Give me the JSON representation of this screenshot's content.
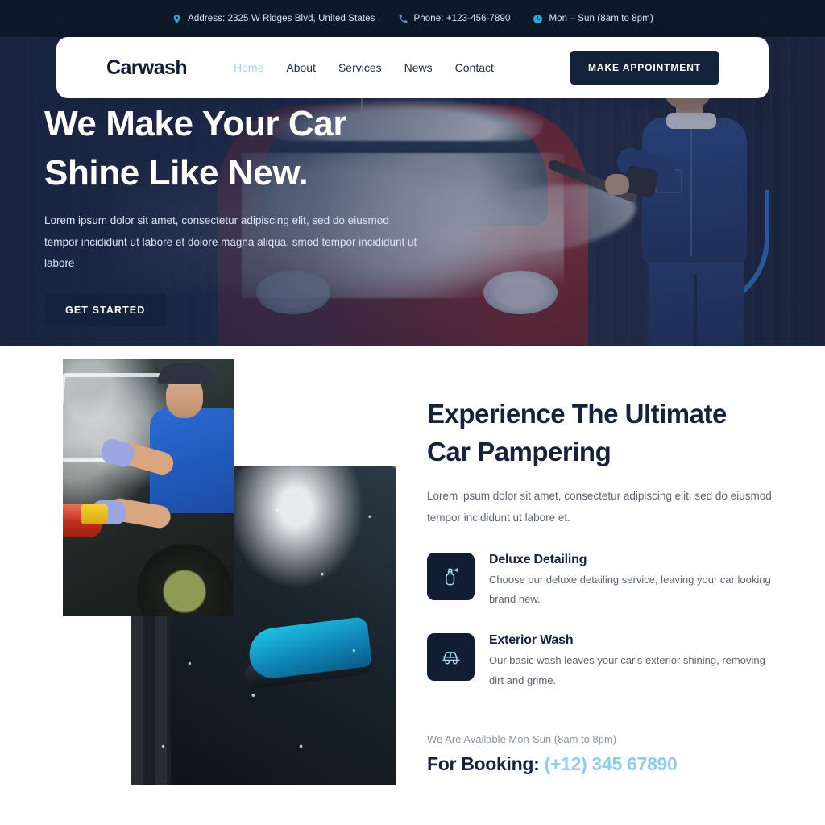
{
  "topbar": {
    "items": [
      {
        "icon": "location-pin-icon",
        "text": "Address: 2325 W Ridges Blvd, United States"
      },
      {
        "icon": "phone-icon",
        "text": "Phone: +123-456-7890"
      },
      {
        "icon": "clock-icon",
        "text": "Mon – Sun (8am to 8pm)"
      }
    ]
  },
  "nav": {
    "brand": "Carwash",
    "links": [
      {
        "label": "Home",
        "active": true
      },
      {
        "label": "About",
        "active": false
      },
      {
        "label": "Services",
        "active": false
      },
      {
        "label": "News",
        "active": false
      },
      {
        "label": "Contact",
        "active": false
      }
    ],
    "cta_label": "MAKE APPOINTMENT"
  },
  "hero": {
    "title_line1": "We Make Your Car",
    "title_line2": "Shine Like New.",
    "paragraph": "Lorem ipsum dolor sit amet, consectetur adipiscing elit, sed do eiusmod tempor incididunt ut labore et dolore magna aliqua. smod tempor incididunt ut labore",
    "cta_label": "GET STARTED"
  },
  "about": {
    "title_line1": "Experience The Ultimate",
    "title_line2": "Car Pampering",
    "paragraph": "Lorem ipsum dolor sit amet, consectetur adipiscing elit, sed do eiusmod tempor incididunt ut labore et.",
    "features": [
      {
        "icon": "spray-bottle-icon",
        "title": "Deluxe Detailing",
        "desc": "Choose our deluxe detailing service, leaving your car looking brand new."
      },
      {
        "icon": "car-icon",
        "title": "Exterior Wash",
        "desc": "Our basic wash leaves your car's exterior shining, removing dirt and grime."
      }
    ],
    "availability": "We Are Available Mon-Sun (8am to 8pm)",
    "booking_label": "For Booking:",
    "booking_phone": "(+12) 345 67890"
  },
  "colors": {
    "navy": "#0d1829",
    "dark_card": "#101d33",
    "accent_light_blue": "#9fd6f0",
    "text_dark": "#15223b",
    "text_muted": "#5b6572"
  }
}
